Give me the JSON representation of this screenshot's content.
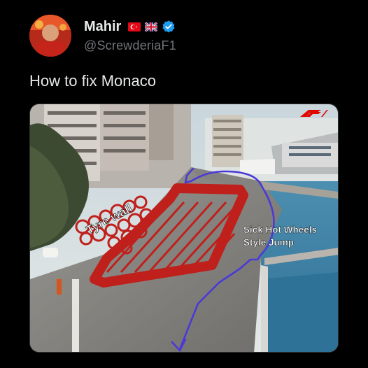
{
  "author": {
    "display_name": "Mahir",
    "handle": "@ScrewderiaF1",
    "flags": [
      "turkey-flag",
      "uk-flag"
    ],
    "verified": true,
    "avatar": "avatar"
  },
  "tweet": {
    "text": "How to fix Monaco"
  },
  "media": {
    "logo": "f1-logo",
    "annotations": {
      "tyre_wall": "Tyre wall",
      "jump_line1": "Sick Hot Wheels",
      "jump_line2": "Style Jump"
    }
  },
  "colors": {
    "background": "#000000",
    "text": "#e7e9ea",
    "secondary_text": "#71767b",
    "verified_blue": "#1d9bf0",
    "annotation_red": "#c0201c",
    "annotation_blue": "#4a3ad6"
  }
}
